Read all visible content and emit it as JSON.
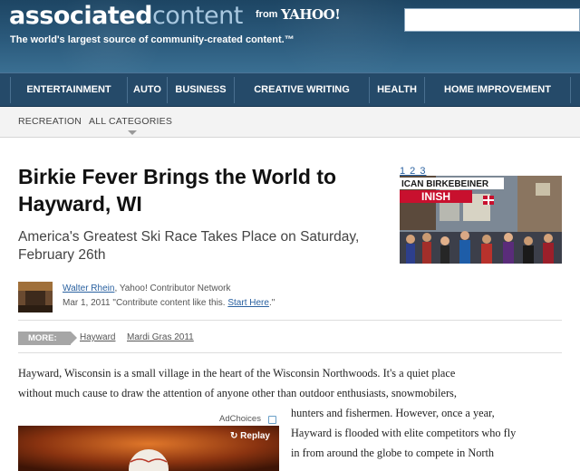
{
  "header": {
    "logo_main": "associated",
    "logo_accent": "content",
    "from_label": "from",
    "yahoo_logo": "YAHOO!",
    "tagline": "The world's largest source of community-created content.™",
    "search_placeholder": ""
  },
  "nav": {
    "items": [
      {
        "label": "ENTERTAINMENT"
      },
      {
        "label": "AUTO"
      },
      {
        "label": "BUSINESS"
      },
      {
        "label": "CREATIVE WRITING"
      },
      {
        "label": "HEALTH"
      },
      {
        "label": "HOME IMPROVEMENT"
      }
    ]
  },
  "subnav": {
    "items": [
      {
        "label": "RECREATION"
      },
      {
        "label": "ALL CATEGORIES"
      }
    ]
  },
  "article": {
    "title": "Birkie Fever Brings the World to Hayward, WI",
    "subtitle": "America's Greatest Ski Race Takes Place on Saturday, February 26th",
    "pager": "1 2 3",
    "photo_banner": "ICAN BIRKEBEINER",
    "photo_finish": "INISH",
    "author_name": "Walter Rhein",
    "author_affiliation": ", Yahoo! Contributor Network",
    "date_text": "Mar 1, 2011 \"Contribute content like this.",
    "start_here": "Start Here",
    "date_suffix": ".\"",
    "more_label": "MORE:",
    "tags": [
      "Hayward",
      "Mardi Gras 2011"
    ],
    "body_lines": [
      "Hayward, Wisconsin is a small village in the heart of the Wisconsin Northwoods. It's a quiet place",
      "without much cause to draw the attention of anyone other than outdoor enthusiasts, snowmobilers,",
      "hunters and  fishermen. However, once a year,",
      "Hayward is flooded with elite competitors who fly",
      "in from around the globe to compete in North"
    ],
    "ad_choices": "AdChoices",
    "replay": "Replay"
  },
  "colors": {
    "header_dark": "#1d4563",
    "nav_bg": "#254a69",
    "link": "#2a61a0",
    "more_bg": "#a6a6a6"
  },
  "icons": [
    "adchoices-icon",
    "replay-icon"
  ]
}
